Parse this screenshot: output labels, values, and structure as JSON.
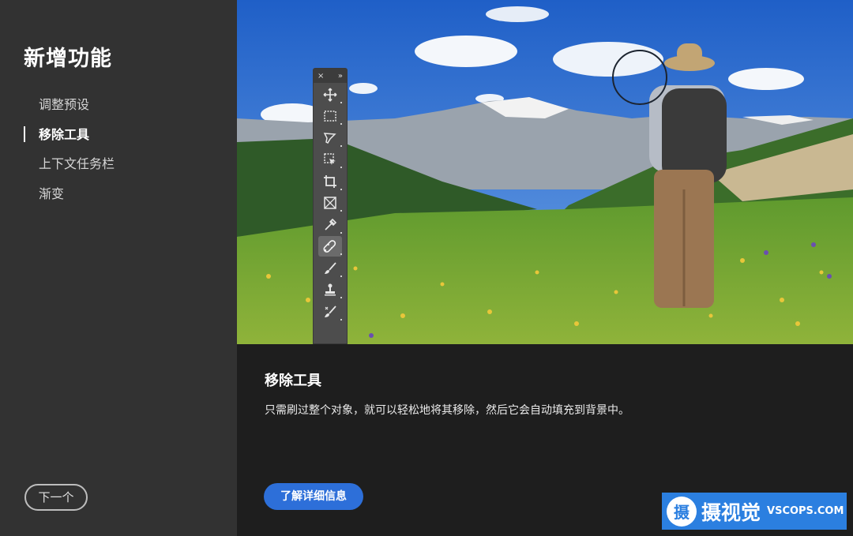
{
  "sidebar": {
    "title": "新增功能",
    "items": [
      {
        "label": "调整预设",
        "active": false
      },
      {
        "label": "移除工具",
        "active": true
      },
      {
        "label": "上下文任务栏",
        "active": false
      },
      {
        "label": "渐变",
        "active": false
      }
    ],
    "next_label": "下一个"
  },
  "toolpanel": {
    "close_glyph": "×",
    "collapse_glyph": "»",
    "tools": [
      "move-icon",
      "marquee-icon",
      "lasso-icon",
      "object-select-icon",
      "crop-icon",
      "frame-icon",
      "eyedropper-icon",
      "remove-tool-icon",
      "brush-icon",
      "stamp-icon",
      "history-brush-icon"
    ],
    "selected_tool": "remove-tool-icon"
  },
  "content": {
    "title": "移除工具",
    "description": "只需刷过整个对象，就可以轻松地将其移除，然后它会自动填充到背景中。",
    "learn_more_label": "了解详细信息"
  },
  "watermark": {
    "logo_char": "摄",
    "text": "摄视觉",
    "domain": "VSCOPS.COM"
  },
  "colors": {
    "sidebar_bg": "#323232",
    "content_bg": "#1e1e1e",
    "accent": "#2d6fd9",
    "watermark_bg": "#2b7fe0"
  }
}
